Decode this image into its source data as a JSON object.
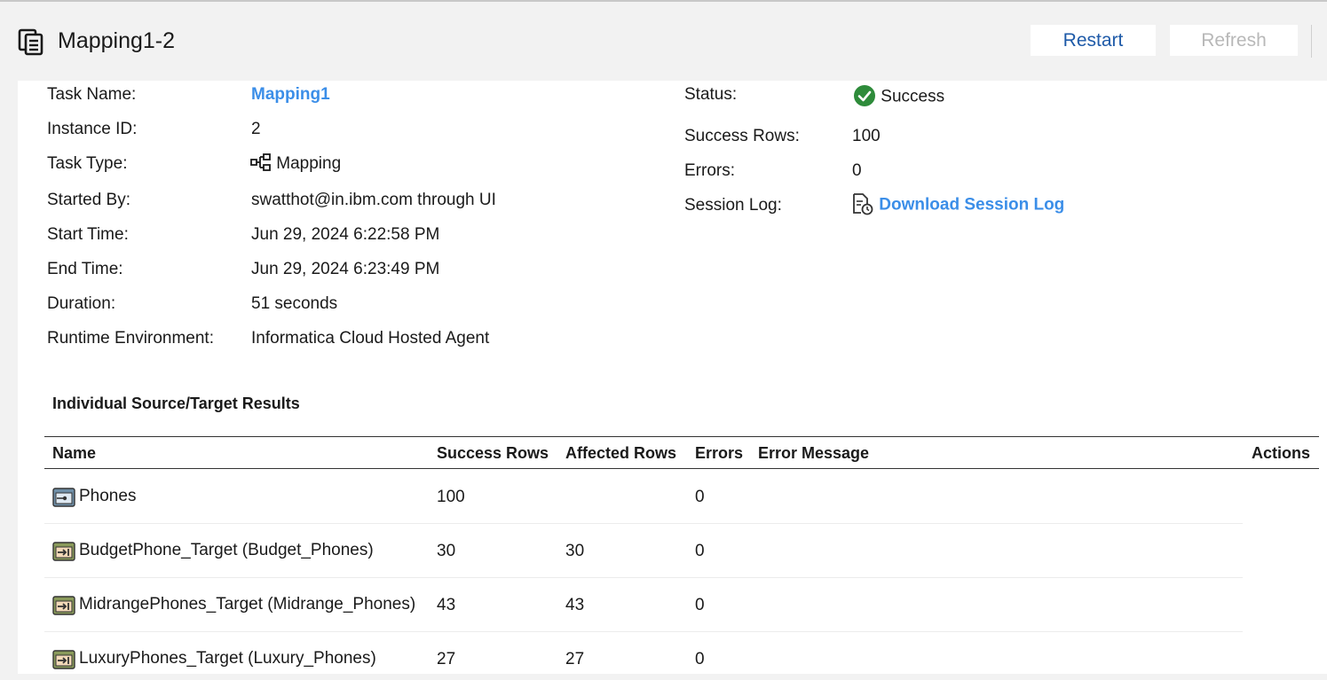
{
  "header": {
    "title": "Mapping1-2",
    "restart_label": "Restart",
    "refresh_label": "Refresh"
  },
  "details_left": [
    {
      "label": "Task Name:",
      "value": "Mapping1"
    },
    {
      "label": "Instance ID:",
      "value": "2"
    },
    {
      "label": "Task Type:",
      "value": "Mapping"
    },
    {
      "label": "Started By:",
      "value": "swatthot@in.ibm.com through UI"
    },
    {
      "label": "Start Time:",
      "value": "Jun 29, 2024 6:22:58 PM"
    },
    {
      "label": "End Time:",
      "value": "Jun 29, 2024 6:23:49 PM"
    },
    {
      "label": "Duration:",
      "value": "51 seconds"
    },
    {
      "label": "Runtime Environment:",
      "value": "Informatica Cloud Hosted Agent"
    }
  ],
  "details_right": [
    {
      "label": "Status:",
      "value": "Success"
    },
    {
      "label": "Success Rows:",
      "value": "100"
    },
    {
      "label": "Errors:",
      "value": "0"
    },
    {
      "label": "Session Log:",
      "value": "Download Session Log"
    }
  ],
  "results": {
    "title": "Individual Source/Target Results",
    "columns": {
      "name": "Name",
      "success_rows": "Success Rows",
      "affected_rows": "Affected Rows",
      "errors": "Errors",
      "error_message": "Error Message",
      "actions": "Actions"
    },
    "rows": [
      {
        "name": "Phones",
        "success_rows": "100",
        "affected_rows": "",
        "errors": "0",
        "icon": "source-icon"
      },
      {
        "name": "BudgetPhone_Target (Budget_Phones)",
        "success_rows": "30",
        "affected_rows": "30",
        "errors": "0",
        "icon": "target-icon"
      },
      {
        "name": "MidrangePhones_Target (Midrange_Phones)",
        "success_rows": "43",
        "affected_rows": "43",
        "errors": "0",
        "icon": "target-icon"
      },
      {
        "name": "LuxuryPhones_Target (Luxury_Phones)",
        "success_rows": "27",
        "affected_rows": "27",
        "errors": "0",
        "icon": "target-icon"
      }
    ]
  },
  "colors": {
    "link": "#3b8ee8",
    "restart": "#1e5aa8",
    "success": "#2e8b3a",
    "disabled": "#b8b8b8"
  }
}
